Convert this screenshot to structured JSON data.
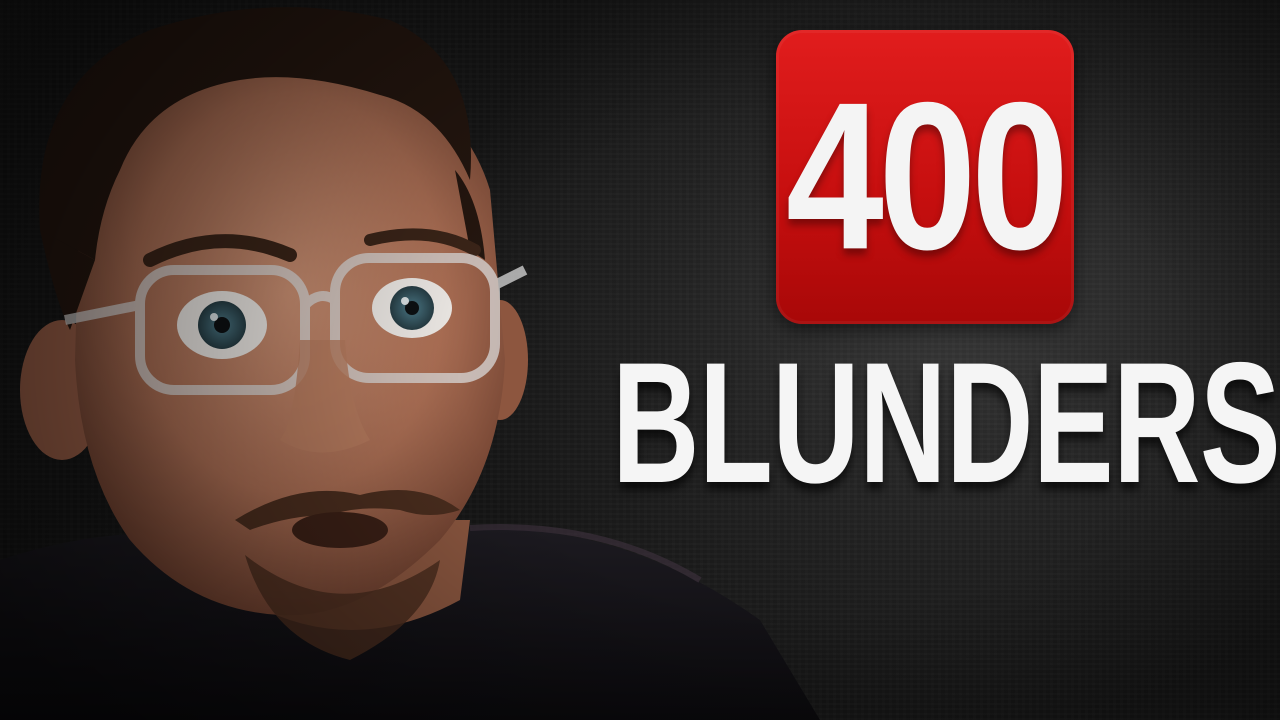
{
  "badge": {
    "number": "400",
    "color": "#d41414"
  },
  "headline": {
    "text": "BLUNDERS"
  },
  "photo": {
    "subject": "surprised-man-with-clear-glasses"
  }
}
